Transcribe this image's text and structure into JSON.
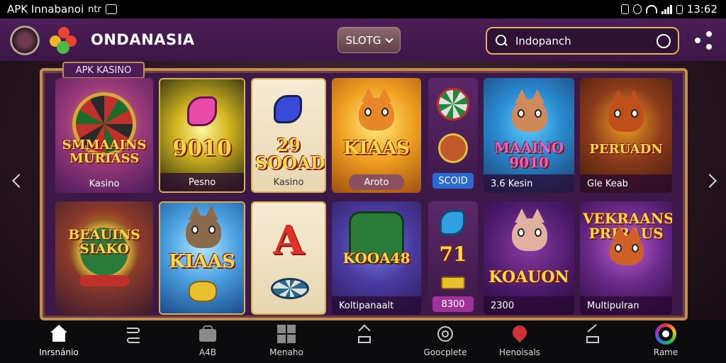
{
  "status_bar": {
    "left_text": "APK Innabanoi",
    "left_extra": "ntr",
    "time": "13:62"
  },
  "header": {
    "brand": "ONDANASIA",
    "dropdown_label": "SLOTG",
    "search_value": "Indopanch"
  },
  "frame_tab": "APK KASINO",
  "tiles_top": [
    {
      "title": "SMMAAINS MURIASS",
      "caption": "Kasino"
    },
    {
      "title": "9010",
      "caption": "Pesno"
    },
    {
      "title": "29 SOOAD",
      "caption": "Kasino"
    },
    {
      "title": "KIAAS",
      "caption": "Aroto"
    },
    {
      "title": "",
      "caption": "SCOID"
    },
    {
      "title": "MAAINO 9010",
      "caption": "3.6 Kesin"
    },
    {
      "title": "PERUADN",
      "caption": "Gle Keab"
    }
  ],
  "tiles_bottom": [
    {
      "title": "BEAUINS SIAKO",
      "caption": ""
    },
    {
      "title": "KIAAS",
      "caption": ""
    },
    {
      "title": "A",
      "caption": ""
    },
    {
      "title": "KOOA48",
      "caption": "Koltipanaalt"
    },
    {
      "title": "71",
      "caption": "8300"
    },
    {
      "title": "KOAUON",
      "caption": "2300"
    },
    {
      "title": "VEKRAANS PRIRAUS",
      "caption": "Multipulran"
    }
  ],
  "bottom_nav": [
    {
      "label": "Inrsnánio",
      "icon": "home-icon"
    },
    {
      "label": "",
      "icon": "swap-arrows-icon"
    },
    {
      "label": "A4B",
      "icon": "wallet-icon"
    },
    {
      "label": "Menaho",
      "icon": "grid-icon"
    },
    {
      "label": "",
      "icon": "share-up-icon"
    },
    {
      "label": "Goocplete",
      "icon": "chat-icon"
    },
    {
      "label": "Henoisals",
      "icon": "heart-pin-icon"
    },
    {
      "label": "",
      "icon": "forward-icon"
    },
    {
      "label": "Rame",
      "icon": "profile-ring-icon"
    }
  ],
  "colors": {
    "header_bg": "#4b1e57",
    "accent_gold": "#e2b25a",
    "frame_border": "#c08e53",
    "nav_bg": "#0c0c0e"
  }
}
